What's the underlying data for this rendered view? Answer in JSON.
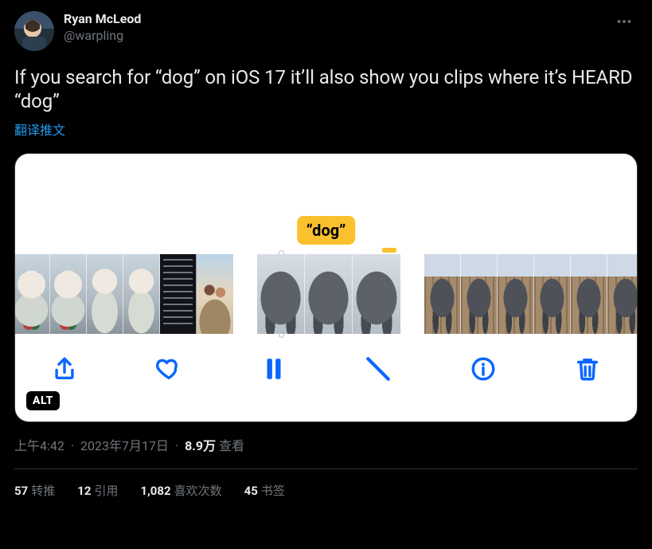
{
  "header": {
    "display_name": "Ryan McLeod",
    "username": "@warpling"
  },
  "tweet": {
    "text": "If you search for “dog” on iOS 17 it’ll also show you clips where it’s HEARD “dog”",
    "translate_label": "翻译推文"
  },
  "media": {
    "speech_tag": "“dog”",
    "alt_badge": "ALT"
  },
  "meta": {
    "time": "上午4:42",
    "date": "2023年7月17日",
    "views_number": "8.9万",
    "views_label": "查看"
  },
  "stats": {
    "retweets_count": "57",
    "retweets_label": "转推",
    "quotes_count": "12",
    "quotes_label": "引用",
    "likes_count": "1,082",
    "likes_label": "喜欢次数",
    "bookmarks_count": "45",
    "bookmarks_label": "书签"
  },
  "icons": {
    "more": "more-icon",
    "share": "share-icon",
    "heart": "heart-icon",
    "pause": "pause-icon",
    "mute": "mute-icon",
    "info": "info-icon",
    "trash": "trash-icon"
  }
}
